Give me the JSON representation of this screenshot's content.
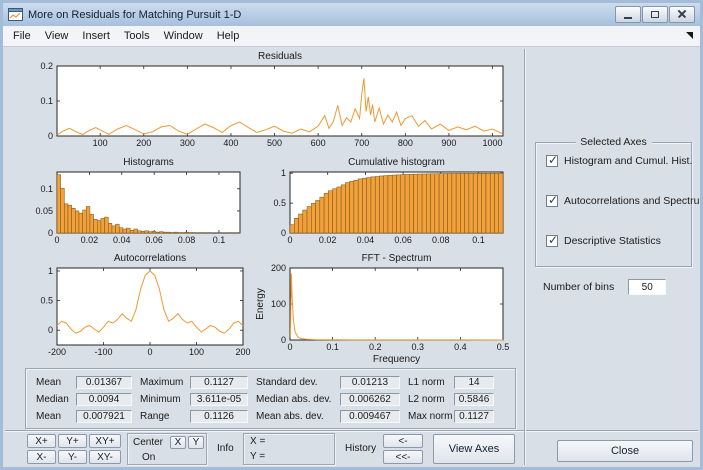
{
  "window": {
    "title": "More on Residuals for Matching Pursuit 1-D"
  },
  "menubar": {
    "items": [
      "File",
      "View",
      "Insert",
      "Tools",
      "Window",
      "Help"
    ]
  },
  "chart_data": [
    {
      "id": "residuals",
      "type": "line",
      "title": "Residuals",
      "xlim": [
        1,
        1024
      ],
      "ylim": [
        0,
        0.2
      ],
      "xticks": [
        100,
        200,
        300,
        400,
        500,
        600,
        700,
        800,
        900,
        1000
      ],
      "yticks": [
        0,
        0.1,
        0.2
      ],
      "line_color": "#ee9933",
      "x": [
        1,
        15,
        30,
        45,
        60,
        75,
        90,
        105,
        120,
        140,
        160,
        180,
        200,
        220,
        240,
        260,
        280,
        300,
        320,
        340,
        360,
        380,
        400,
        420,
        440,
        460,
        480,
        500,
        520,
        540,
        560,
        580,
        600,
        615,
        625,
        635,
        645,
        655,
        665,
        675,
        685,
        695,
        700,
        705,
        710,
        715,
        720,
        725,
        730,
        740,
        750,
        760,
        770,
        780,
        790,
        800,
        815,
        830,
        845,
        860,
        880,
        900,
        920,
        940,
        960,
        980,
        1000,
        1024
      ],
      "y": [
        0.003,
        0.014,
        0.022,
        0.012,
        0.004,
        0.016,
        0.024,
        0.014,
        0.005,
        0.02,
        0.03,
        0.018,
        0.006,
        0.012,
        0.026,
        0.03,
        0.014,
        0.005,
        0.02,
        0.034,
        0.024,
        0.01,
        0.03,
        0.04,
        0.024,
        0.01,
        0.018,
        0.028,
        0.014,
        0.008,
        0.02,
        0.012,
        0.028,
        0.058,
        0.022,
        0.042,
        0.088,
        0.03,
        0.052,
        0.04,
        0.078,
        0.05,
        0.118,
        0.165,
        0.07,
        0.112,
        0.06,
        0.09,
        0.04,
        0.08,
        0.034,
        0.06,
        0.04,
        0.068,
        0.03,
        0.05,
        0.058,
        0.028,
        0.044,
        0.02,
        0.034,
        0.016,
        0.026,
        0.018,
        0.028,
        0.014,
        0.02,
        0.006
      ]
    },
    {
      "id": "histogram",
      "type": "bar",
      "title": "Histograms",
      "xlim": [
        0,
        0.113
      ],
      "ylim": [
        0,
        0.138
      ],
      "xticks": [
        0,
        0.02,
        0.04,
        0.06,
        0.08,
        0.1
      ],
      "yticks": [
        0,
        0.05,
        0.1
      ],
      "bar_fill": "#f0a13c",
      "bar_edge": "#7a4f10",
      "bins": {
        "start": 0,
        "width": 0.00226
      },
      "values": [
        0.132,
        0.101,
        0.066,
        0.063,
        0.056,
        0.05,
        0.045,
        0.052,
        0.06,
        0.042,
        0.031,
        0.028,
        0.033,
        0.036,
        0.022,
        0.016,
        0.02,
        0.012,
        0.009,
        0.011,
        0.006,
        0.009,
        0.005,
        0.004,
        0.005,
        0.003,
        0.004,
        0.002,
        0.003,
        0.002,
        0.002,
        0.001,
        0.002,
        0.001,
        0.001,
        0.002,
        0.001,
        0.001,
        0,
        0.001,
        0,
        0.001,
        0,
        0,
        0.001,
        0,
        0,
        0.001,
        0,
        0.001
      ]
    },
    {
      "id": "cumhist",
      "type": "bar",
      "title": "Cumulative histogram",
      "xlim": [
        0,
        0.113
      ],
      "ylim": [
        0,
        1.02
      ],
      "xticks": [
        0,
        0.02,
        0.04,
        0.06,
        0.08,
        0.1
      ],
      "yticks": [
        0,
        0.5,
        1
      ],
      "bar_fill": "#f0a13c",
      "bar_edge": "#7a4f10",
      "bins": {
        "start": 0,
        "width": 0.00226
      },
      "values": [
        0.14,
        0.247,
        0.317,
        0.384,
        0.443,
        0.496,
        0.544,
        0.599,
        0.663,
        0.707,
        0.74,
        0.77,
        0.805,
        0.843,
        0.866,
        0.883,
        0.905,
        0.917,
        0.927,
        0.939,
        0.945,
        0.954,
        0.96,
        0.964,
        0.969,
        0.972,
        0.977,
        0.979,
        0.982,
        0.984,
        0.986,
        0.987,
        0.989,
        0.99,
        0.991,
        0.994,
        0.995,
        0.996,
        0.996,
        0.997,
        0.997,
        0.998,
        0.998,
        0.998,
        0.999,
        0.999,
        0.999,
        1,
        1,
        1
      ]
    },
    {
      "id": "autocorr",
      "type": "line",
      "title": "Autocorrelations",
      "xlim": [
        -200,
        200
      ],
      "ylim": [
        -0.25,
        1.05
      ],
      "xticks": [
        -200,
        -100,
        0,
        100,
        200
      ],
      "yticks": [
        0,
        0.5,
        1
      ],
      "line_color": "#ee9933",
      "x": [
        -200,
        -190,
        -180,
        -170,
        -160,
        -150,
        -140,
        -130,
        -120,
        -110,
        -100,
        -90,
        -80,
        -70,
        -60,
        -50,
        -40,
        -30,
        -20,
        -10,
        0,
        10,
        20,
        30,
        40,
        50,
        60,
        70,
        80,
        90,
        100,
        110,
        120,
        130,
        140,
        150,
        160,
        170,
        180,
        190,
        200
      ],
      "y": [
        0.08,
        0.15,
        0.12,
        0.02,
        -0.05,
        -0.02,
        0.05,
        0.08,
        0.02,
        -0.03,
        0.05,
        0.15,
        0.12,
        0.18,
        0.28,
        0.2,
        0.15,
        0.35,
        0.7,
        0.93,
        1,
        0.93,
        0.7,
        0.35,
        0.15,
        0.2,
        0.28,
        0.18,
        0.12,
        0.15,
        0.05,
        -0.03,
        0.02,
        0.08,
        0.05,
        -0.02,
        -0.05,
        0.02,
        0.12,
        0.15,
        0.08
      ]
    },
    {
      "id": "fft",
      "type": "line",
      "title": "FFT - Spectrum",
      "xlabel": "Frequency",
      "ylabel": "Energy",
      "xlim": [
        0,
        0.5
      ],
      "ylim": [
        0,
        200
      ],
      "xticks": [
        0,
        0.1,
        0.2,
        0.3,
        0.4,
        0.5
      ],
      "yticks": [
        0,
        100,
        200
      ],
      "line_color": "#ee9933",
      "x": [
        0.001,
        0.003,
        0.005,
        0.008,
        0.012,
        0.018,
        0.025,
        0.04,
        0.06,
        0.1,
        0.15,
        0.2,
        0.3,
        0.4,
        0.5
      ],
      "y": [
        8,
        185,
        120,
        55,
        22,
        9,
        4,
        2,
        1,
        0.5,
        0.4,
        0.3,
        0.2,
        0.2,
        0.1
      ]
    }
  ],
  "stats": {
    "rows": [
      {
        "c": [
          {
            "label": "Mean",
            "value": "0.01367"
          },
          {
            "label": "Maximum",
            "value": "0.1127"
          },
          {
            "label": "Standard dev.",
            "value": "0.01213"
          },
          {
            "label": "L1 norm",
            "value": "14"
          }
        ]
      },
      {
        "c": [
          {
            "label": "Median",
            "value": "0.0094"
          },
          {
            "label": "Minimum",
            "value": "3.611e-05"
          },
          {
            "label": "Median abs. dev.",
            "value": "0.006262"
          },
          {
            "label": "L2 norm",
            "value": "0.5846"
          }
        ]
      },
      {
        "c": [
          {
            "label": "Mean",
            "value": "0.007921"
          },
          {
            "label": "Range",
            "value": "0.1126"
          },
          {
            "label": "Mean abs. dev.",
            "value": "0.009467"
          },
          {
            "label": "Max norm",
            "value": "0.1127"
          }
        ]
      }
    ]
  },
  "toolbar": {
    "zoom_buttons": [
      "X+",
      "Y+",
      "XY+",
      "X-",
      "Y-",
      "XY-"
    ],
    "center_label": "Center",
    "center_x": "X",
    "center_y": "Y",
    "on_label": "On",
    "info_label": "Info",
    "info_x": "X =",
    "info_y": "Y =",
    "history_label": "History",
    "history_back": "<-",
    "history_back_all": "<<-",
    "view_axes": "View Axes"
  },
  "panel": {
    "group_title": "Selected Axes",
    "checkboxes": [
      {
        "label": "Histogram and Cumul. Hist.",
        "checked": true
      },
      {
        "label": "Autocorrelations and Spectrum",
        "checked": true
      },
      {
        "label": "Descriptive Statistics",
        "checked": true
      }
    ],
    "bins_label": "Number of bins",
    "bins_value": "50",
    "close_label": "Close"
  }
}
